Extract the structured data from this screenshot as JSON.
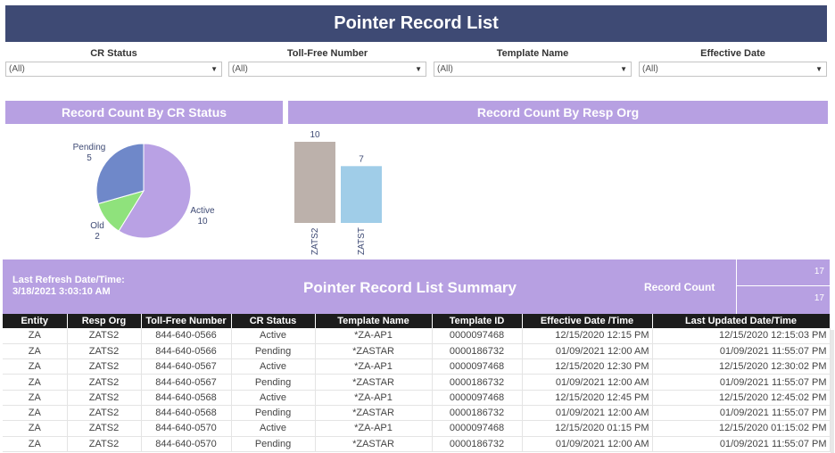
{
  "title": "Pointer Record List",
  "filters": [
    {
      "label": "CR Status",
      "value": "(All)"
    },
    {
      "label": "Toll-Free Number",
      "value": "(All)"
    },
    {
      "label": "Template Name",
      "value": "(All)"
    },
    {
      "label": "Effective Date",
      "value": "(All)"
    }
  ],
  "sections": {
    "cr_status": "Record Count By CR Status",
    "resp_org": "Record Count By Resp Org"
  },
  "chart_data": [
    {
      "type": "pie",
      "title": "Record Count By CR Status",
      "slices": [
        {
          "label": "Active",
          "value": 10,
          "color": "#b9a1e4"
        },
        {
          "label": "Old",
          "value": 2,
          "color": "#8fe27c"
        },
        {
          "label": "Pending",
          "value": 5,
          "color": "#6f88c9"
        }
      ]
    },
    {
      "type": "bar",
      "title": "Record Count By Resp Org",
      "categories": [
        "ZATS2",
        "ZATST"
      ],
      "values": [
        10,
        7
      ],
      "colors": [
        "#bcb1ab",
        "#a0cde8"
      ],
      "ylim": [
        0,
        10
      ]
    }
  ],
  "summary": {
    "refresh_label": "Last Refresh Date/Time:",
    "refresh_value": "3/18/2021 3:03:10 AM",
    "title": "Pointer Record List Summary",
    "record_count_label": "Record Count",
    "record_count_1": "17",
    "record_count_2": "17"
  },
  "table": {
    "columns": [
      "Entity",
      "Resp Org",
      "Toll-Free Number",
      "CR Status",
      "Template Name",
      "Template ID",
      "Effective Date /Time",
      "Last Updated Date/Time"
    ],
    "rows": [
      [
        "ZA",
        "ZATS2",
        "844-640-0566",
        "Active",
        "*ZA-AP1",
        "0000097468",
        "12/15/2020 12:15 PM",
        "12/15/2020 12:15:03 PM"
      ],
      [
        "ZA",
        "ZATS2",
        "844-640-0566",
        "Pending",
        "*ZASTAR",
        "0000186732",
        "01/09/2021 12:00 AM",
        "01/09/2021 11:55:07 PM"
      ],
      [
        "ZA",
        "ZATS2",
        "844-640-0567",
        "Active",
        "*ZA-AP1",
        "0000097468",
        "12/15/2020 12:30 PM",
        "12/15/2020 12:30:02 PM"
      ],
      [
        "ZA",
        "ZATS2",
        "844-640-0567",
        "Pending",
        "*ZASTAR",
        "0000186732",
        "01/09/2021 12:00 AM",
        "01/09/2021 11:55:07 PM"
      ],
      [
        "ZA",
        "ZATS2",
        "844-640-0568",
        "Active",
        "*ZA-AP1",
        "0000097468",
        "12/15/2020 12:45 PM",
        "12/15/2020 12:45:02 PM"
      ],
      [
        "ZA",
        "ZATS2",
        "844-640-0568",
        "Pending",
        "*ZASTAR",
        "0000186732",
        "01/09/2021 12:00 AM",
        "01/09/2021 11:55:07 PM"
      ],
      [
        "ZA",
        "ZATS2",
        "844-640-0570",
        "Active",
        "*ZA-AP1",
        "0000097468",
        "12/15/2020 01:15 PM",
        "12/15/2020 01:15:02 PM"
      ],
      [
        "ZA",
        "ZATS2",
        "844-640-0570",
        "Pending",
        "*ZASTAR",
        "0000186732",
        "01/09/2021 12:00 AM",
        "01/09/2021 11:55:07 PM"
      ]
    ]
  }
}
